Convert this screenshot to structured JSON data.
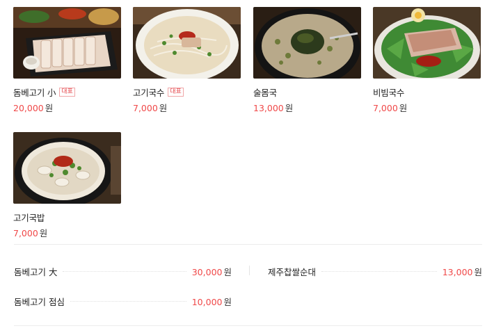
{
  "menu_cards": [
    {
      "name": "돔베고기 小",
      "badge": "대표",
      "price": "20,000",
      "unit": "원",
      "image": "boiled-pork-board-photo"
    },
    {
      "name": "고기국수",
      "badge": "대표",
      "price": "7,000",
      "unit": "원",
      "image": "pork-noodle-soup-photo"
    },
    {
      "name": "술몸국",
      "badge": "",
      "price": "13,000",
      "unit": "원",
      "image": "seaweed-stew-photo"
    },
    {
      "name": "비빔국수",
      "badge": "",
      "price": "7,000",
      "unit": "원",
      "image": "spicy-noodle-photo"
    },
    {
      "name": "고기국밥",
      "badge": "",
      "price": "7,000",
      "unit": "원",
      "image": "pork-rice-soup-photo"
    }
  ],
  "menu_list": [
    {
      "name": "돔베고기 大",
      "price": "30,000",
      "unit": "원"
    },
    {
      "name": "제주찹쌀순대",
      "price": "13,000",
      "unit": "원"
    },
    {
      "name": "돔베고기 점심",
      "price": "10,000",
      "unit": "원"
    }
  ]
}
